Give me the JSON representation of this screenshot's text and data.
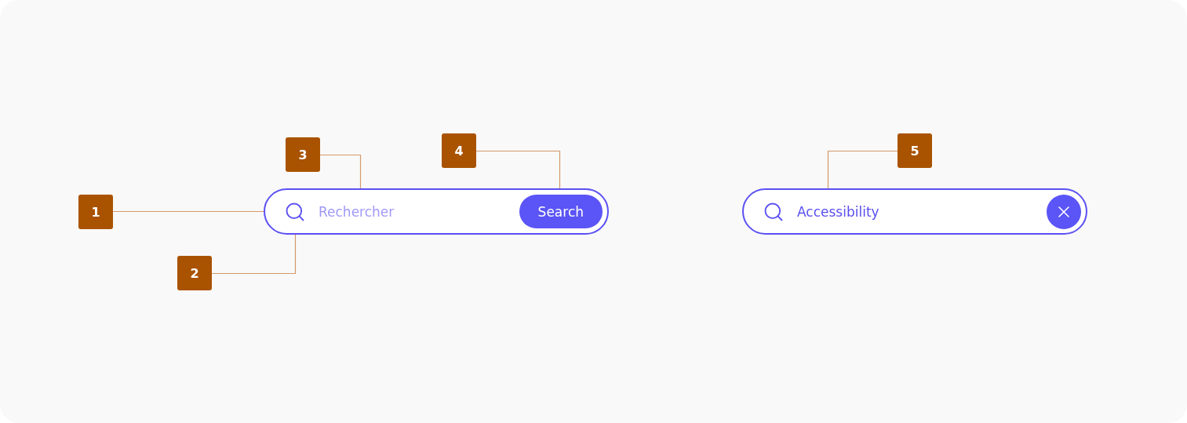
{
  "search_fields": [
    {
      "placeholder": "Rechercher",
      "action": {
        "kind": "button",
        "label": "Search"
      }
    },
    {
      "value": "Accessibility",
      "action": {
        "kind": "clear"
      }
    }
  ],
  "callouts": [
    {
      "label": "1"
    },
    {
      "label": "2"
    },
    {
      "label": "3"
    },
    {
      "label": "4"
    },
    {
      "label": "5"
    }
  ]
}
